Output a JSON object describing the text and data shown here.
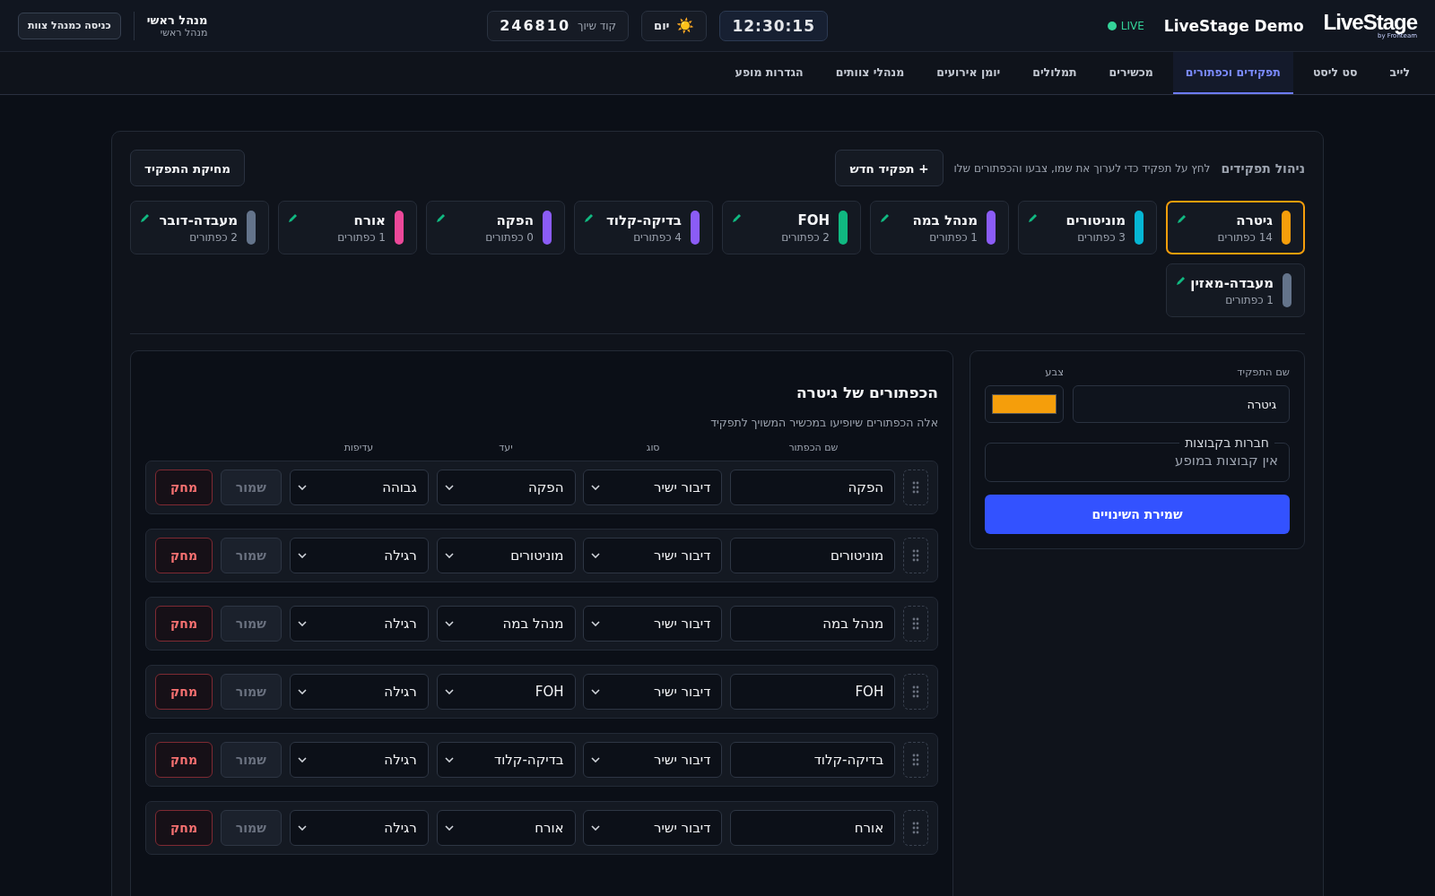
{
  "header": {
    "logo": "LiveStage",
    "logo_sub": "by Fronteam",
    "title": "LiveStage Demo",
    "live": "LIVE",
    "clock": "12:30:15",
    "mode": {
      "icon": "☀️",
      "label": "יום"
    },
    "pair_code": {
      "label": "קוד שיוך",
      "value": "246810"
    },
    "user": {
      "name": "מנהל ראשי",
      "role": "מנהל ראשי"
    },
    "enter_button": "כניסה כמנהל צוות"
  },
  "tabs": [
    {
      "label": "לייב",
      "selected": false
    },
    {
      "label": "סט ליסט",
      "selected": false
    },
    {
      "label": "תפקידים וכפתורים",
      "selected": true
    },
    {
      "label": "מכשירים",
      "selected": false
    },
    {
      "label": "תמלולים",
      "selected": false
    },
    {
      "label": "יומן אירועים",
      "selected": false
    },
    {
      "label": "מנהלי צוותים",
      "selected": false
    },
    {
      "label": "הגדרות מופע",
      "selected": false
    }
  ],
  "roles_panel": {
    "title": "ניהול תפקידים",
    "hint": "לחץ על תפקיד כדי לערוך את שמו, צבעו והכפתורים שלו",
    "new_button": "+ תפקיד חדש",
    "delete_button": "מחיקת התפקיד",
    "roles": [
      {
        "name": "גיטרה",
        "count": "14 כפתורים",
        "color": "#f59e0b",
        "selected": true
      },
      {
        "name": "מוניטורים",
        "count": "3 כפתורים",
        "color": "#06b6d4",
        "selected": false
      },
      {
        "name": "מנהל במה",
        "count": "1 כפתורים",
        "color": "#8b5cf6",
        "selected": false
      },
      {
        "name": "FOH",
        "count": "2 כפתורים",
        "color": "#10b981",
        "selected": false
      },
      {
        "name": "בדיקה-קלוד",
        "count": "4 כפתורים",
        "color": "#8b5cf6",
        "selected": false
      },
      {
        "name": "הפקה",
        "count": "0 כפתורים",
        "color": "#8b5cf6",
        "selected": false
      },
      {
        "name": "אורח",
        "count": "1 כפתורים",
        "color": "#ec4899",
        "selected": false
      },
      {
        "name": "מעבדה-דובר",
        "count": "2 כפתורים",
        "color": "#64748b",
        "selected": false
      },
      {
        "name": "מעבדה-מאזין",
        "count": "1 כפתורים",
        "color": "#64748b",
        "selected": false
      }
    ]
  },
  "editor": {
    "name_label": "שם התפקיד",
    "name_value": "גיטרה",
    "color_label": "צבע",
    "color": "#f59e0b",
    "groups_label": "חברות בקבוצות",
    "groups_empty": "אין קבוצות במופע",
    "save_button": "שמירת השינויים"
  },
  "buttons_panel": {
    "title": "הכפתורים של גיטרה",
    "subtitle": "אלה הכפתורים שיופיעו במכשיר המשויך לתפקיד",
    "columns": [
      "שם הכפתור",
      "סוג",
      "יעד",
      "עדיפות"
    ],
    "rows": [
      {
        "name": "הפקה",
        "type": "דיבור ישיר",
        "target": "הפקה",
        "priority": "גבוהה",
        "save_label": "שמור",
        "delete_label": "מחק"
      },
      {
        "name": "מוניטורים",
        "type": "דיבור ישיר",
        "target": "מוניטורים",
        "priority": "רגילה",
        "save_label": "שמור",
        "delete_label": "מחק"
      },
      {
        "name": "מנהל במה",
        "type": "דיבור ישיר",
        "target": "מנהל במה",
        "priority": "רגילה",
        "save_label": "שמור",
        "delete_label": "מחק"
      },
      {
        "name": "FOH",
        "type": "דיבור ישיר",
        "target": "FOH",
        "priority": "רגילה",
        "save_label": "שמור",
        "delete_label": "מחק"
      },
      {
        "name": "בדיקה-קלוד",
        "type": "דיבור ישיר",
        "target": "בדיקה-קלוד",
        "priority": "רגילה",
        "save_label": "שמור",
        "delete_label": "מחק"
      },
      {
        "name": "אורח",
        "type": "דיבור ישיר",
        "target": "אורח",
        "priority": "רגילה",
        "save_label": "שמור",
        "delete_label": "מחק"
      }
    ]
  }
}
